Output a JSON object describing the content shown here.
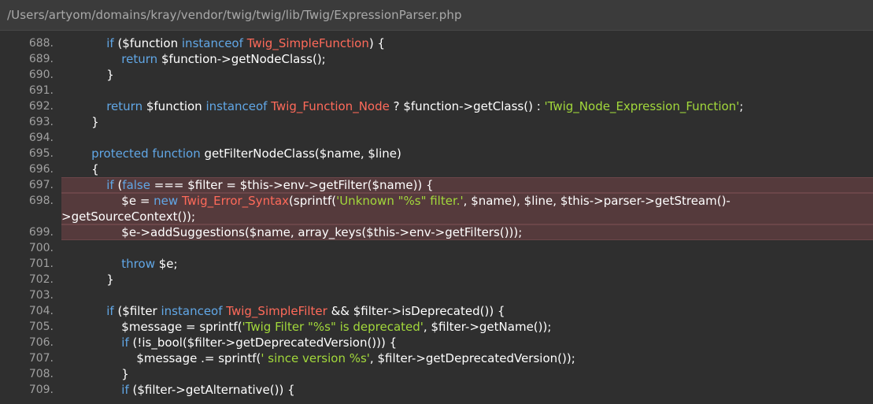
{
  "file_path": "/Users/artyom/domains/kray/vendor/twig/twig/lib/Twig/ExpressionParser.php",
  "colors": {
    "keyword": "#61a7e6",
    "class_name": "#ff6a5a",
    "string": "#a2d83b",
    "plain": "#ffffff",
    "highlight_bg": "#553a3c"
  },
  "lines": [
    {
      "no": "688.",
      "highlight": false,
      "rows": [
        [
          [
            "",
            "            "
          ],
          [
            "kw",
            "if"
          ],
          [
            "",
            " ($function "
          ],
          [
            "kw",
            "instanceof"
          ],
          [
            "",
            " "
          ],
          [
            "cls",
            "Twig_SimpleFunction"
          ],
          [
            "",
            ") {"
          ]
        ]
      ]
    },
    {
      "no": "689.",
      "highlight": false,
      "rows": [
        [
          [
            "",
            "                "
          ],
          [
            "kw",
            "return"
          ],
          [
            "",
            " $function->getNodeClass();"
          ]
        ]
      ]
    },
    {
      "no": "690.",
      "highlight": false,
      "rows": [
        [
          [
            "",
            "            }"
          ]
        ]
      ]
    },
    {
      "no": "691.",
      "highlight": false,
      "rows": [
        [
          [
            "",
            ""
          ]
        ]
      ]
    },
    {
      "no": "692.",
      "highlight": false,
      "rows": [
        [
          [
            "",
            "            "
          ],
          [
            "kw",
            "return"
          ],
          [
            "",
            " $function "
          ],
          [
            "kw",
            "instanceof"
          ],
          [
            "",
            " "
          ],
          [
            "cls",
            "Twig_Function_Node"
          ],
          [
            "",
            " ? $function->getClass() : "
          ],
          [
            "str",
            "'Twig_Node_Expression_Function'"
          ],
          [
            "",
            ";"
          ]
        ]
      ]
    },
    {
      "no": "693.",
      "highlight": false,
      "rows": [
        [
          [
            "",
            "        }"
          ]
        ]
      ]
    },
    {
      "no": "694.",
      "highlight": false,
      "rows": [
        [
          [
            "",
            ""
          ]
        ]
      ]
    },
    {
      "no": "695.",
      "highlight": false,
      "rows": [
        [
          [
            "",
            "        "
          ],
          [
            "kw",
            "protected"
          ],
          [
            "",
            " "
          ],
          [
            "kw",
            "function"
          ],
          [
            "",
            " getFilterNodeClass($name, $line)"
          ]
        ]
      ]
    },
    {
      "no": "696.",
      "highlight": false,
      "rows": [
        [
          [
            "",
            "        {"
          ]
        ]
      ]
    },
    {
      "no": "697.",
      "highlight": true,
      "rows": [
        [
          [
            "",
            "            "
          ],
          [
            "kw",
            "if"
          ],
          [
            "",
            " ("
          ],
          [
            "kw",
            "false"
          ],
          [
            "",
            " === $filter = $this->env->getFilter($name)) {"
          ]
        ]
      ]
    },
    {
      "no": "698.",
      "highlight": true,
      "rows": [
        [
          [
            "",
            "                $e = "
          ],
          [
            "kw",
            "new"
          ],
          [
            "",
            " "
          ],
          [
            "cls",
            "Twig_Error_Syntax"
          ],
          [
            "",
            "(sprintf("
          ],
          [
            "str",
            "'Unknown \"%s\" filter.'"
          ],
          [
            "",
            ", $name), $line, $this->parser->getStream()-"
          ]
        ],
        [
          [
            "",
            ">getSourceContext());"
          ]
        ]
      ]
    },
    {
      "no": "699.",
      "highlight": true,
      "rows": [
        [
          [
            "",
            "                $e->addSuggestions($name, array_keys($this->env->getFilters()));"
          ]
        ]
      ]
    },
    {
      "no": "700.",
      "highlight": false,
      "rows": [
        [
          [
            "",
            ""
          ]
        ]
      ]
    },
    {
      "no": "701.",
      "highlight": false,
      "rows": [
        [
          [
            "",
            "                "
          ],
          [
            "kw",
            "throw"
          ],
          [
            "",
            " $e;"
          ]
        ]
      ]
    },
    {
      "no": "702.",
      "highlight": false,
      "rows": [
        [
          [
            "",
            "            }"
          ]
        ]
      ]
    },
    {
      "no": "703.",
      "highlight": false,
      "rows": [
        [
          [
            "",
            ""
          ]
        ]
      ]
    },
    {
      "no": "704.",
      "highlight": false,
      "rows": [
        [
          [
            "",
            "            "
          ],
          [
            "kw",
            "if"
          ],
          [
            "",
            " ($filter "
          ],
          [
            "kw",
            "instanceof"
          ],
          [
            "",
            " "
          ],
          [
            "cls",
            "Twig_SimpleFilter"
          ],
          [
            "",
            " && $filter->isDeprecated()) {"
          ]
        ]
      ]
    },
    {
      "no": "705.",
      "highlight": false,
      "rows": [
        [
          [
            "",
            "                $message = sprintf("
          ],
          [
            "str",
            "'Twig Filter \"%s\" is deprecated'"
          ],
          [
            "",
            ", $filter->getName());"
          ]
        ]
      ]
    },
    {
      "no": "706.",
      "highlight": false,
      "rows": [
        [
          [
            "",
            "                "
          ],
          [
            "kw",
            "if"
          ],
          [
            "",
            " (!is_bool($filter->getDeprecatedVersion())) {"
          ]
        ]
      ]
    },
    {
      "no": "707.",
      "highlight": false,
      "rows": [
        [
          [
            "",
            "                    $message .= sprintf("
          ],
          [
            "str",
            "' since version %s'"
          ],
          [
            "",
            ", $filter->getDeprecatedVersion());"
          ]
        ]
      ]
    },
    {
      "no": "708.",
      "highlight": false,
      "rows": [
        [
          [
            "",
            "                }"
          ]
        ]
      ]
    },
    {
      "no": "709.",
      "highlight": false,
      "rows": [
        [
          [
            "",
            "                "
          ],
          [
            "kw",
            "if"
          ],
          [
            "",
            " ($filter->getAlternative()) {"
          ]
        ]
      ]
    }
  ]
}
